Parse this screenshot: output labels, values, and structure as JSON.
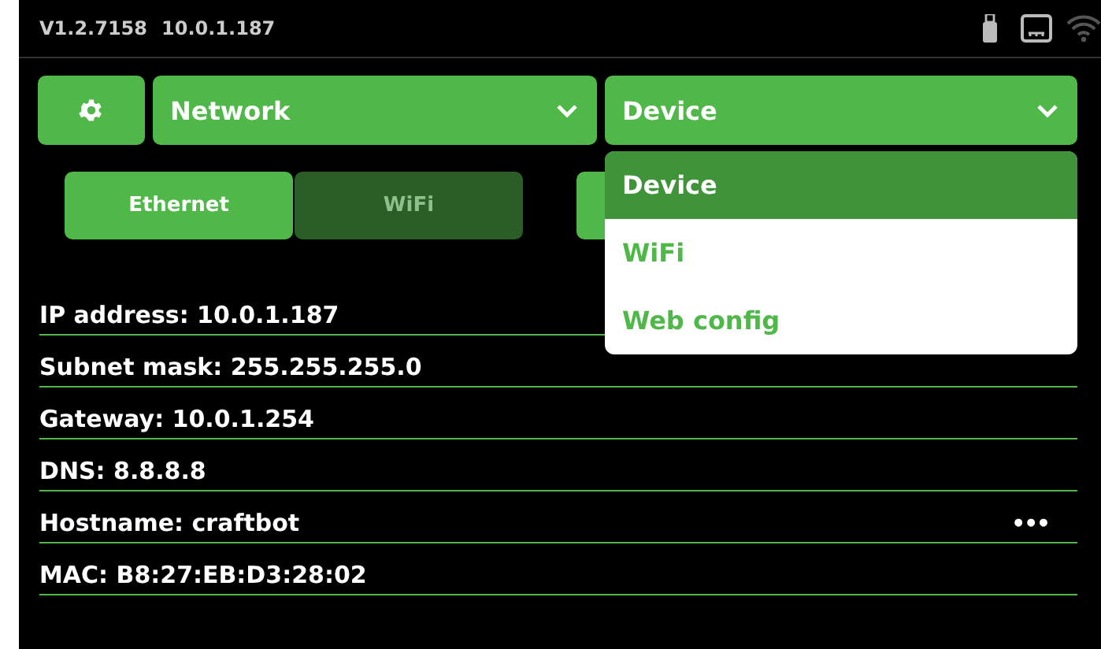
{
  "status_bar": {
    "version": "V1.2.7158",
    "ip": "10.0.1.187"
  },
  "header": {
    "category_dropdown": {
      "label": "Network"
    },
    "section_dropdown": {
      "label": "Device",
      "expanded": true
    }
  },
  "dropdown_menu": [
    {
      "label": "Device",
      "selected": true
    },
    {
      "label": "WiFi",
      "selected": false
    },
    {
      "label": "Web config",
      "selected": false
    }
  ],
  "tabs": [
    {
      "label": "Ethernet",
      "selected": true
    },
    {
      "label": "WiFi",
      "selected": false
    }
  ],
  "info_rows": [
    {
      "text": "IP address: 10.0.1.187"
    },
    {
      "text": "Subnet mask: 255.255.255.0"
    },
    {
      "text": "Gateway: 10.0.1.254"
    },
    {
      "text": "DNS: 8.8.8.8"
    },
    {
      "text": "Hostname: craftbot",
      "action": "•••"
    },
    {
      "text": "MAC: B8:27:EB:D3:28:02"
    }
  ]
}
